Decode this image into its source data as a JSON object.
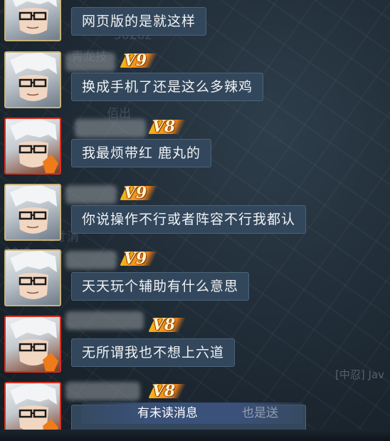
{
  "messages": [
    {
      "vip": "",
      "text": "网页版的是就这样",
      "frame": "gold"
    },
    {
      "vip": "V9",
      "text": "换成手机了还是这么多辣鸡",
      "frame": "gold"
    },
    {
      "vip": "V8",
      "text": "我最烦带红 鹿丸的",
      "frame": "red"
    },
    {
      "vip": "V9",
      "text": "你说操作不行或者阵容不行我都认",
      "frame": "gold"
    },
    {
      "vip": "V9",
      "text": "天天玩个辅助有什么意思",
      "frame": "gold"
    },
    {
      "vip": "V8",
      "text": "无所谓我也不想上六道",
      "frame": "red"
    },
    {
      "vip": "V8",
      "text": "",
      "frame": "red"
    }
  ],
  "unread_banner": "有未读消息",
  "ghost_labels": {
    "right_tag": "[中忍] Jav",
    "bottom_partial": "也是送"
  },
  "colors": {
    "bubble": "#33475c",
    "vip_orange": "#f0811a",
    "frame_gold": "#c9b37a",
    "frame_red": "#d82f1f",
    "banner": "#3a5179"
  }
}
